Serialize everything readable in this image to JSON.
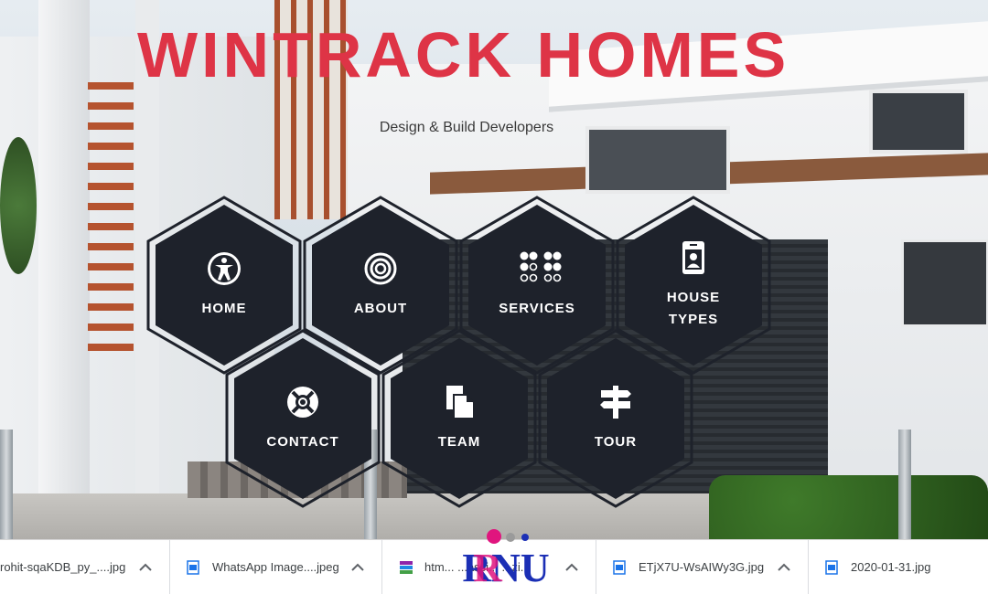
{
  "site": {
    "title": "WINTRACK HOMES",
    "tagline": "Design & Build Developers",
    "accent_color": "#de3446",
    "hex_color": "#1e222b"
  },
  "menu": [
    {
      "label": "HOME",
      "icon": "accessibility-person-icon"
    },
    {
      "label": "ABOUT",
      "icon": "target-circles-icon"
    },
    {
      "label": "SERVICES",
      "icon": "dots-grid-icon"
    },
    {
      "label": "HOUSE TYPES",
      "icon": "id-badge-icon"
    },
    {
      "label": "CONTACT",
      "icon": "lifebuoy-icon"
    },
    {
      "label": "TEAM",
      "icon": "documents-icon"
    },
    {
      "label": "TOUR",
      "icon": "signpost-icon"
    }
  ],
  "downloads": [
    {
      "name": "rohit-sqaKDB_py_....jpg",
      "icon": "image-file-icon"
    },
    {
      "name": "WhatsApp Image....jpeg",
      "icon": "image-file-icon"
    },
    {
      "name": "htm... ...assi... ...zi...",
      "icon": "archive-file-icon"
    },
    {
      "name": "ETjX7U-WsAIWy3G.jpg",
      "icon": "image-file-icon"
    },
    {
      "name": "2020-01-31.jpg",
      "icon": "image-file-icon"
    }
  ],
  "overlay_logo": {
    "text": "RNU",
    "colors": [
      "#e0157e",
      "#1b2fb5"
    ]
  }
}
